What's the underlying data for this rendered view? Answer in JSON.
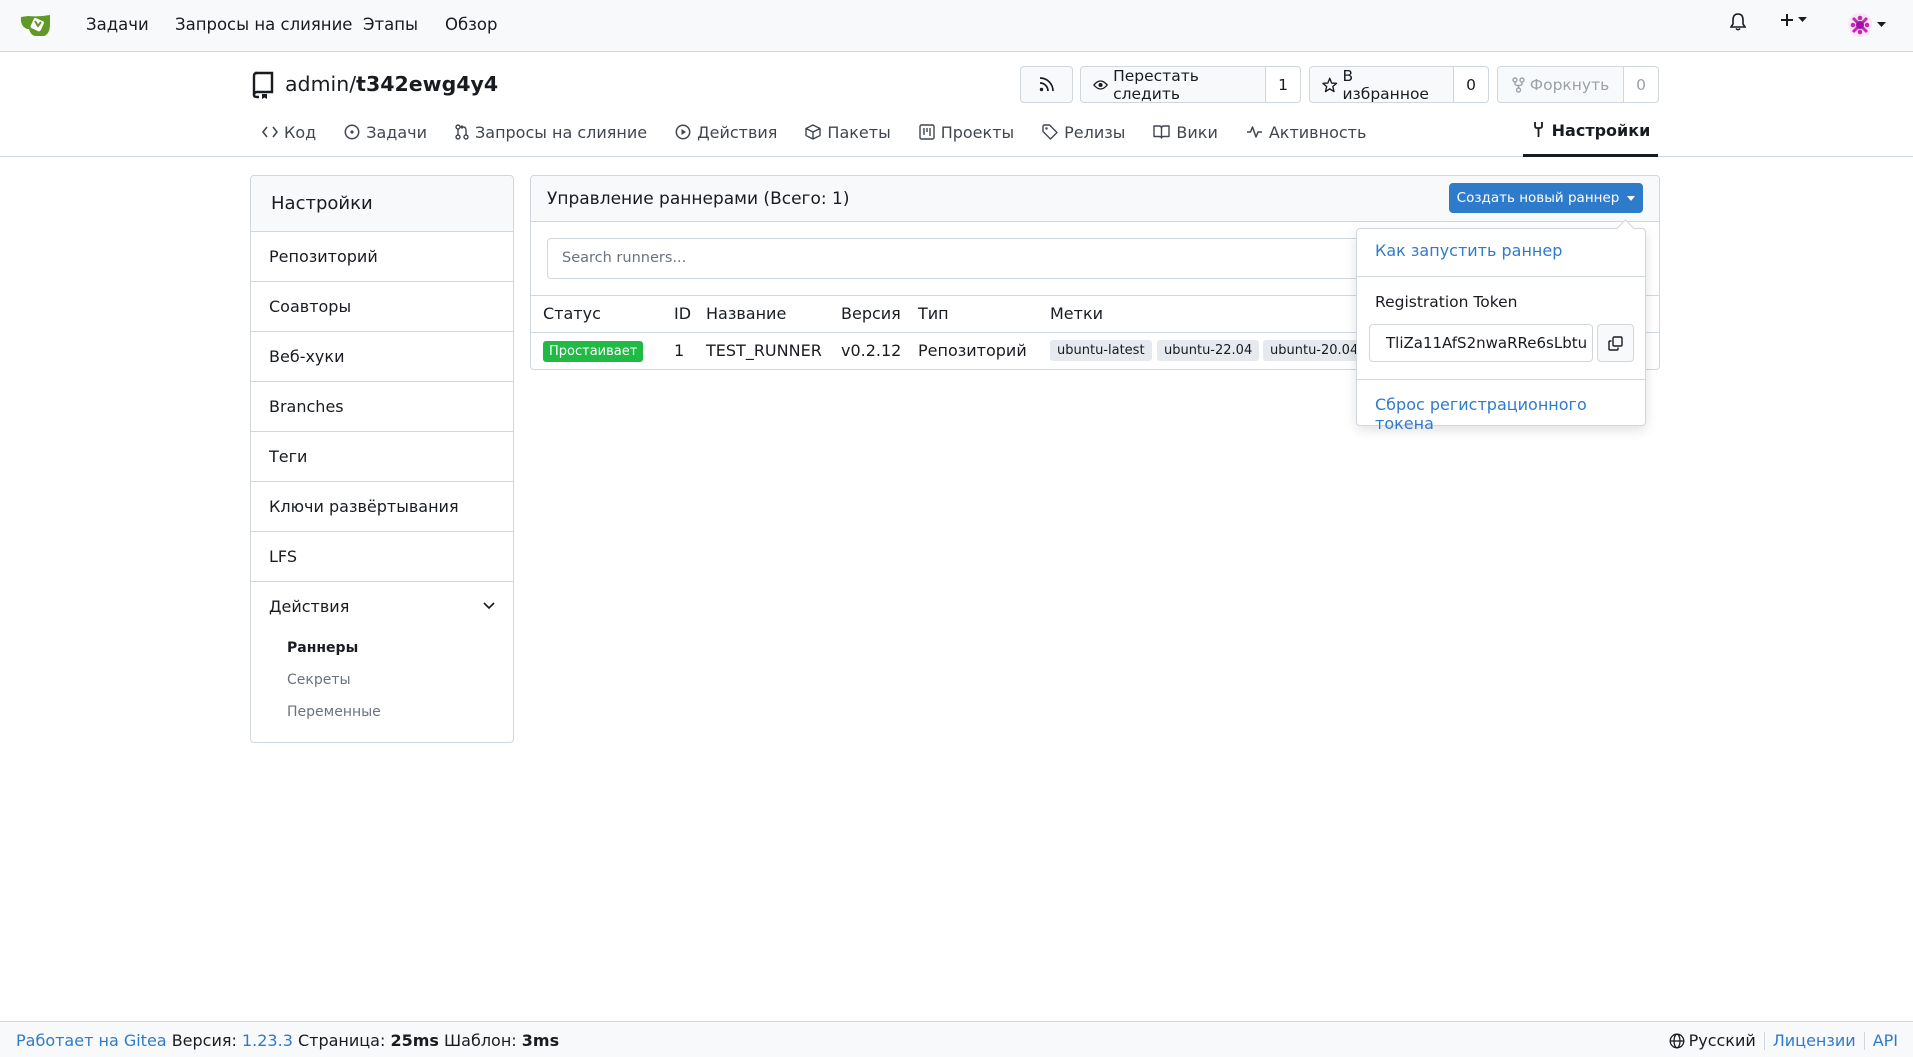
{
  "colors": {
    "accent": "#2f7bcb",
    "brand": "#609926",
    "status_active": "#21ba45"
  },
  "topnav": {
    "items": [
      "Задачи",
      "Запросы на слияние",
      "Этапы",
      "Обзор"
    ],
    "icons": [
      "gitea-logo-icon",
      "bell-icon",
      "plus-icon",
      "avatar"
    ]
  },
  "repo": {
    "owner": "admin",
    "separator": "/",
    "name": "t342ewg4y4",
    "watch_label": "Перестать следить",
    "watch_count": "1",
    "star_label": "В избранное",
    "star_count": "0",
    "fork_label": "Форкнуть",
    "fork_count": "0"
  },
  "tabs": {
    "code": "Код",
    "issues": "Задачи",
    "pulls": "Запросы на слияние",
    "actions": "Действия",
    "packages": "Пакеты",
    "projects": "Проекты",
    "releases": "Релизы",
    "wiki": "Вики",
    "activity": "Активность",
    "settings": "Настройки"
  },
  "sidebar": {
    "title": "Настройки",
    "items": [
      "Репозиторий",
      "Соавторы",
      "Веб-хуки",
      "Branches",
      "Теги",
      "Ключи развёртывания",
      "LFS"
    ],
    "actions_label": "Действия",
    "sub_items": [
      "Раннеры",
      "Секреты",
      "Переменные"
    ]
  },
  "runners": {
    "title": "Управление раннерами (Всего: 1)",
    "create_button": "Создать новый раннер",
    "search_placeholder": "Search runners...",
    "columns": [
      "Статус",
      "ID",
      "Название",
      "Версия",
      "Тип",
      "Метки"
    ],
    "rows": [
      {
        "status": "Простаивает",
        "id": "1",
        "name": "TEST_RUNNER",
        "version": "v0.2.12",
        "type": "Репозиторий",
        "labels": [
          "ubuntu-latest",
          "ubuntu-22.04",
          "ubuntu-20.04"
        ]
      }
    ]
  },
  "dropdown": {
    "how_to_run": "Как запустить раннер",
    "token_label": "Registration Token",
    "token_value": "TliZa11AfS2nwaRRe6sLbtu",
    "reset_token": "Сброс регистрационного токена"
  },
  "footer": {
    "powered": "Работает на Gitea",
    "version_label": "Версия:",
    "version": "1.23.3",
    "page_label": "Страница:",
    "page_time": "25ms",
    "template_label": "Шаблон:",
    "template_time": "3ms",
    "language": "Русский",
    "licenses": "Лицензии",
    "api": "API"
  }
}
